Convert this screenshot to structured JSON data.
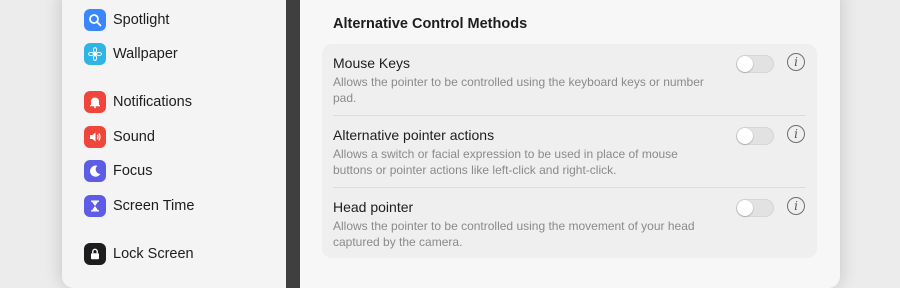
{
  "sidebar": {
    "items": [
      {
        "label": "Spotlight",
        "icon": "magnifier-icon",
        "color": "#3a86ff"
      },
      {
        "label": "Wallpaper",
        "icon": "flower-icon",
        "color": "#2fb4e6"
      },
      {
        "label": "Notifications",
        "icon": "bell-icon",
        "color": "#f0453a"
      },
      {
        "label": "Sound",
        "icon": "speaker-icon",
        "color": "#f0453a"
      },
      {
        "label": "Focus",
        "icon": "moon-icon",
        "color": "#5e5ce6"
      },
      {
        "label": "Screen Time",
        "icon": "hourglass-icon",
        "color": "#5e5ce6"
      },
      {
        "label": "Lock Screen",
        "icon": "lock-icon",
        "color": "#1d1d1f"
      }
    ]
  },
  "main": {
    "section_title": "Alternative Control Methods",
    "rows": [
      {
        "title": "Mouse Keys",
        "description": "Allows the pointer to be controlled using the keyboard keys or number pad.",
        "enabled": false
      },
      {
        "title": "Alternative pointer actions",
        "description": "Allows a switch or facial expression to be used in place of mouse buttons or pointer actions like left-click and right-click.",
        "enabled": false
      },
      {
        "title": "Head pointer",
        "description": "Allows the pointer to be controlled using the movement of your head captured by the camera.",
        "enabled": false
      }
    ],
    "info_glyph": "i"
  }
}
